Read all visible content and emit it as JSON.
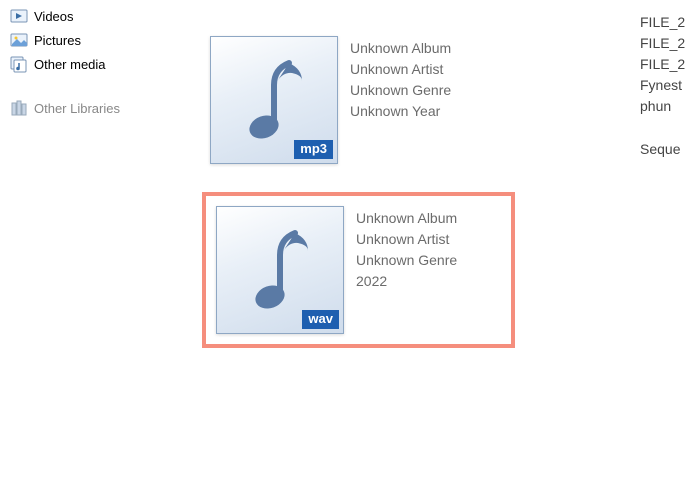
{
  "sidebar": {
    "items": [
      {
        "label": "Videos"
      },
      {
        "label": "Pictures"
      },
      {
        "label": "Other media"
      }
    ],
    "section_label": "Other Libraries"
  },
  "files": [
    {
      "format": "mp3",
      "album": "Unknown Album",
      "artist": "Unknown Artist",
      "genre": "Unknown Genre",
      "year": "Unknown Year"
    },
    {
      "format": "wav",
      "album": "Unknown Album",
      "artist": "Unknown Artist",
      "genre": "Unknown Genre",
      "year": "2022"
    }
  ],
  "right_list": [
    "FILE_2",
    "FILE_2",
    "FILE_2",
    "Fynest",
    "phun"
  ],
  "right_list_after": [
    "Seque"
  ]
}
